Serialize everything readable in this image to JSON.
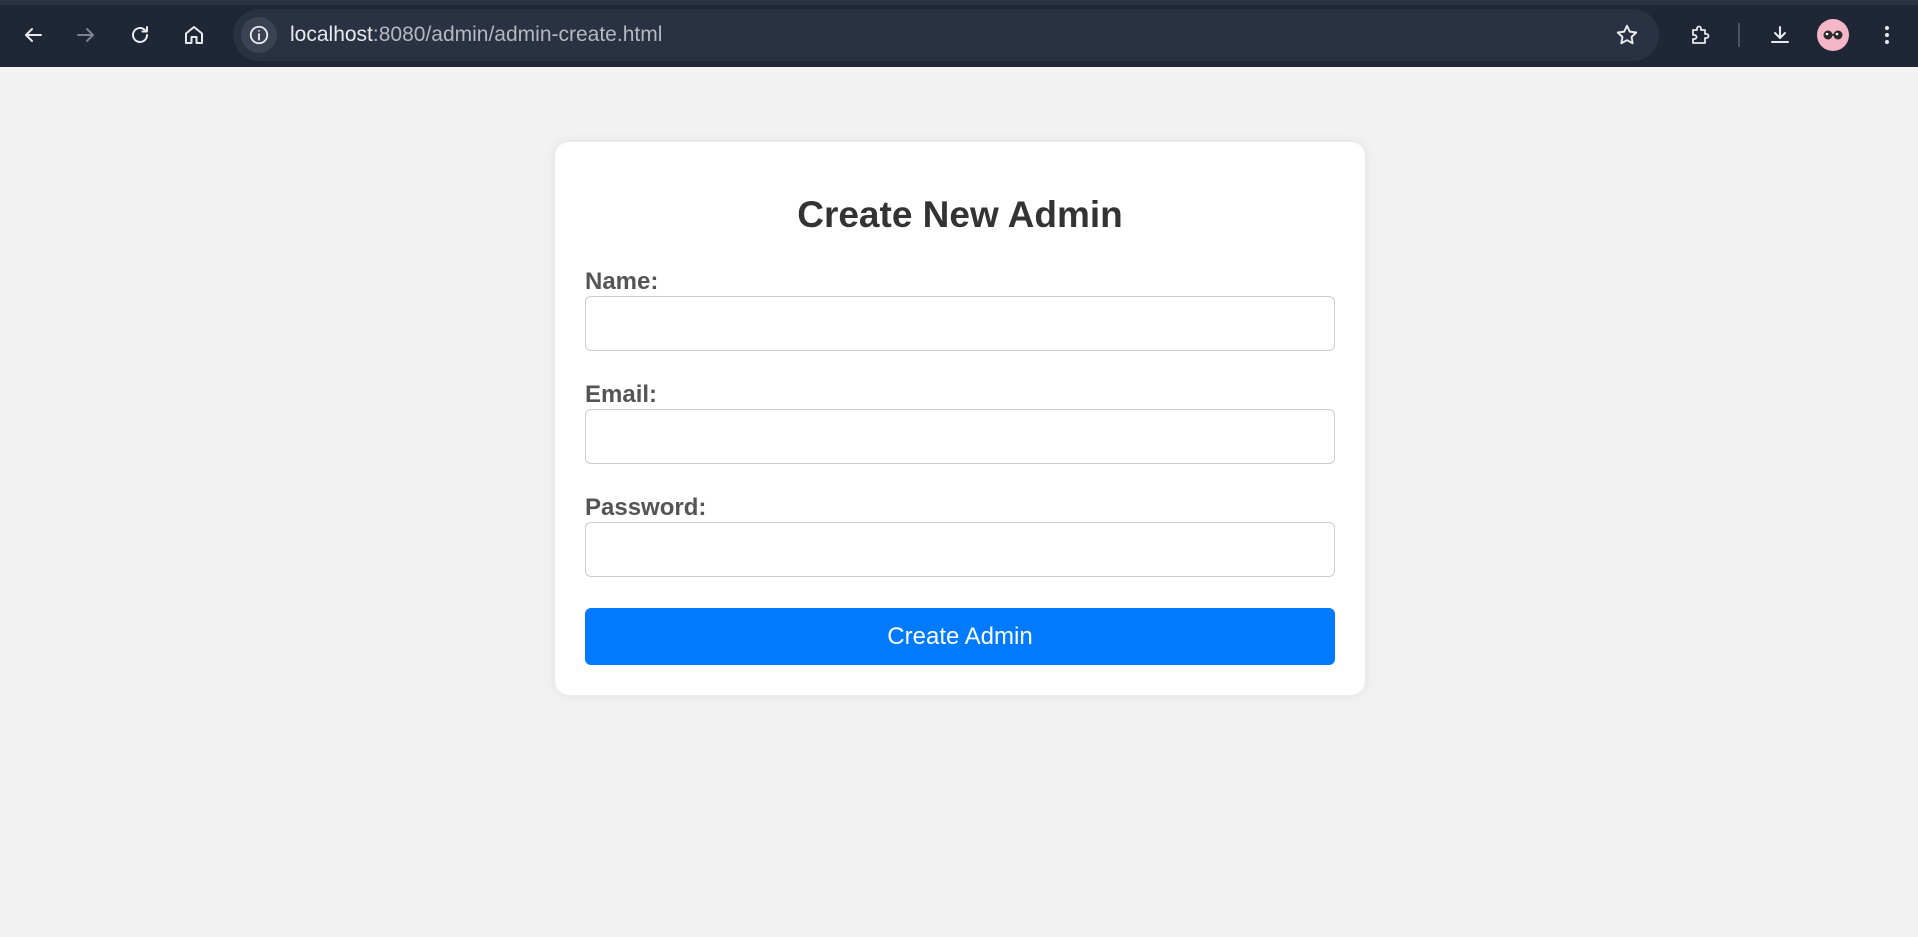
{
  "browser": {
    "url_host": "localhost",
    "url_path": ":8080/admin/admin-create.html",
    "icons": {
      "back": "arrow-left-icon",
      "forward": "arrow-right-icon",
      "reload": "reload-icon",
      "home": "home-icon",
      "site_info": "info-icon",
      "bookmark": "star-icon",
      "extensions": "puzzle-icon",
      "downloads": "download-icon",
      "menu": "kebab-menu-icon"
    },
    "colors": {
      "toolbar_bg": "#1f2636",
      "omnibox_bg": "#2a3142"
    }
  },
  "form": {
    "title": "Create New Admin",
    "fields": [
      {
        "label": "Name:",
        "value": "",
        "placeholder": ""
      },
      {
        "label": "Email:",
        "value": "",
        "placeholder": ""
      },
      {
        "label": "Password:",
        "value": "",
        "placeholder": ""
      }
    ],
    "submit_label": "Create Admin",
    "colors": {
      "page_bg": "#f2f2f2",
      "card_bg": "#ffffff",
      "submit_bg": "#007bff",
      "title_color": "#333333",
      "label_color": "#555555"
    }
  }
}
